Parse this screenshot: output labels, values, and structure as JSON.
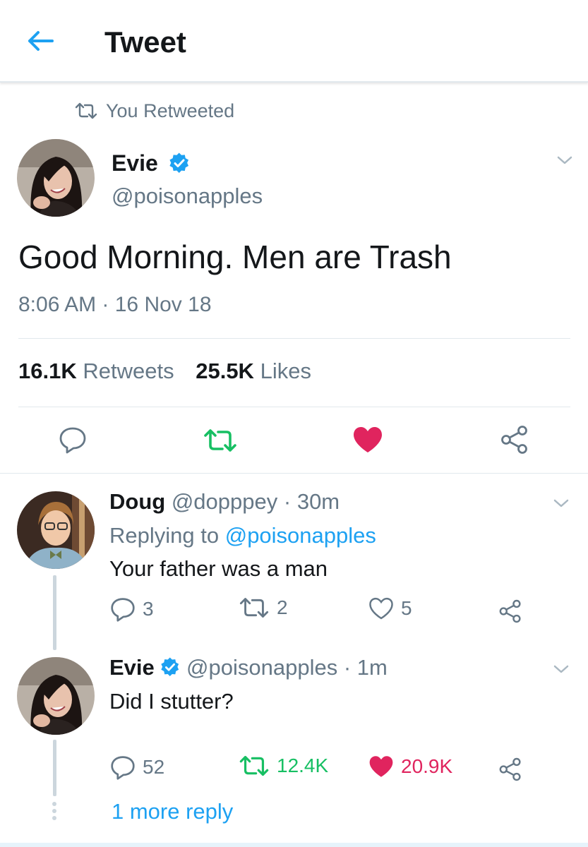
{
  "header": {
    "title": "Tweet"
  },
  "retweet_context": {
    "label": "You Retweeted"
  },
  "main_tweet": {
    "author_name": "Evie",
    "handle": "@poisonapples",
    "text": "Good Morning. Men are Trash",
    "time": "8:06 AM",
    "date": "16 Nov 18",
    "retweet_count": "16.1K",
    "retweets_label": "Retweets",
    "like_count": "25.5K",
    "likes_label": "Likes"
  },
  "replies": [
    {
      "author_name": "Doug",
      "handle": "@dopppey",
      "time": "30m",
      "replying_label": "Replying to",
      "replying_to": "@poisonapples",
      "text": "Your father was a man",
      "reply_count": "3",
      "retweet_count": "2",
      "like_count": "5"
    },
    {
      "author_name": "Evie",
      "handle": "@poisonapples",
      "time": "1m",
      "text": "Did I stutter?",
      "reply_count": "52",
      "retweet_count": "12.4K",
      "like_count": "20.9K"
    }
  ],
  "more_replies": {
    "label": "1 more reply"
  },
  "colors": {
    "accent": "#1da1f2",
    "retweet_green": "#17bf63",
    "like_red": "#e0245e",
    "muted_text": "#657786",
    "text": "#14171a"
  },
  "icons": [
    "back-arrow-icon",
    "retweet-icon",
    "verified-badge-icon",
    "chevron-down-icon",
    "reply-icon",
    "like-icon",
    "share-icon"
  ]
}
